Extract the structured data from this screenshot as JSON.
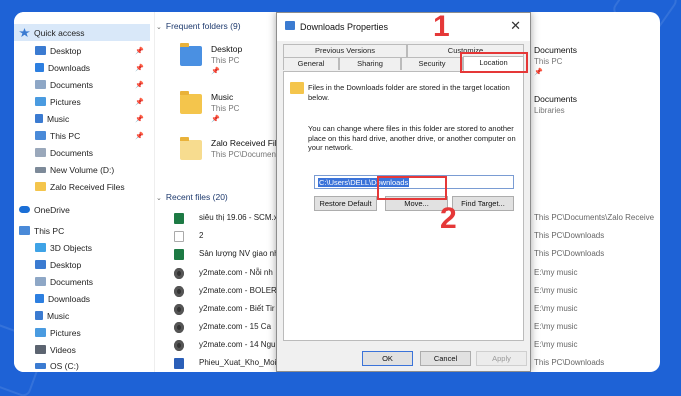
{
  "nav": {
    "items": [
      {
        "label": "Quick access",
        "icon": "star-icon",
        "pinned": false
      },
      {
        "label": "Desktop",
        "icon": "desktop-icon",
        "pinned": true
      },
      {
        "label": "Downloads",
        "icon": "download-icon",
        "pinned": true
      },
      {
        "label": "Documents",
        "icon": "documents-icon",
        "pinned": true
      },
      {
        "label": "Pictures",
        "icon": "pictures-icon",
        "pinned": true
      },
      {
        "label": "Music",
        "icon": "music-icon",
        "pinned": true
      },
      {
        "label": "This PC",
        "icon": "computer-icon",
        "pinned": true
      },
      {
        "label": "Documents",
        "icon": "documents-icon",
        "pinned": false
      },
      {
        "label": "New Volume (D:)",
        "icon": "drive-icon",
        "pinned": false
      },
      {
        "label": "Zalo Received Files",
        "icon": "folder-icon",
        "pinned": false
      },
      {
        "label": "OneDrive",
        "icon": "cloud-icon",
        "pinned": false
      },
      {
        "label": "This PC",
        "icon": "computer-icon",
        "pinned": false
      },
      {
        "label": "3D Objects",
        "icon": "cube-icon",
        "pinned": false
      },
      {
        "label": "Desktop",
        "icon": "desktop-icon",
        "pinned": false
      },
      {
        "label": "Documents",
        "icon": "documents-icon",
        "pinned": false
      },
      {
        "label": "Downloads",
        "icon": "download-icon",
        "pinned": false
      },
      {
        "label": "Music",
        "icon": "music-icon",
        "pinned": false
      },
      {
        "label": "Pictures",
        "icon": "pictures-icon",
        "pinned": false
      },
      {
        "label": "Videos",
        "icon": "videos-icon",
        "pinned": false
      },
      {
        "label": "OS (C:)",
        "icon": "drive-icon",
        "pinned": false
      }
    ]
  },
  "frequent": {
    "header": "Frequent folders (9)",
    "left": [
      {
        "name": "Desktop",
        "location": "This PC",
        "pin": "📌"
      },
      {
        "name": "Music",
        "location": "This PC",
        "pin": "📌"
      },
      {
        "name": "Zalo Received Files",
        "location": "This PC\\Documen",
        "pin": ""
      }
    ],
    "right": [
      {
        "name": "Documents",
        "location": "This PC",
        "pin": "📌"
      },
      {
        "name": "Documents",
        "location": "Libraries",
        "pin": ""
      }
    ]
  },
  "recent": {
    "header": "Recent files (20)",
    "rows": [
      {
        "name": "siêu thị 19.06 - SCM.x",
        "location": "This PC\\Documents\\Zalo Receive",
        "icon": "excel-icon"
      },
      {
        "name": "2",
        "location": "This PC\\Downloads",
        "icon": "blank-file-icon"
      },
      {
        "name": "Sản lượng NV giao nh",
        "location": "This PC\\Downloads",
        "icon": "excel-icon"
      },
      {
        "name": "y2mate.com - Nỗi nh",
        "location": "E:\\my music",
        "icon": "audio-icon"
      },
      {
        "name": "y2mate.com - BOLER",
        "location": "E:\\my music",
        "icon": "audio-icon"
      },
      {
        "name": "y2mate.com - Biết Tir",
        "location": "E:\\my music",
        "icon": "audio-icon"
      },
      {
        "name": "y2mate.com - 15 Ca",
        "location": "E:\\my music",
        "icon": "audio-icon"
      },
      {
        "name": "y2mate.com - 14 Ngu",
        "location": "E:\\my music",
        "icon": "audio-icon"
      },
      {
        "name": "Phieu_Xuat_Kho_Moi.",
        "location": "This PC\\Downloads",
        "icon": "word-icon"
      }
    ]
  },
  "dialog": {
    "title": "Downloads Properties",
    "close": "✕",
    "tabs_row1": [
      "Previous Versions",
      "Customize"
    ],
    "tabs_row2": [
      "General",
      "Sharing",
      "Security",
      "Location"
    ],
    "active_tab": "Location",
    "info_text_1": "Files in the Downloads folder are stored in the target location below.",
    "info_text_2": "You can change where files in this folder are stored to another place on this hard drive, another drive, or another computer on your network.",
    "path_value": "C:\\Users\\DELL\\Downloads",
    "buttons_row": {
      "restore": "Restore Default",
      "move": "Move...",
      "find": "Find Target..."
    },
    "footer": {
      "ok": "OK",
      "cancel": "Cancel",
      "apply": "Apply"
    }
  },
  "annotations": {
    "step1": "1",
    "step2": "2",
    "color": "#e53838"
  },
  "colors": {
    "background": "#1e62d6",
    "accent": "#3b73d9",
    "selection": "#d9e8f9"
  }
}
